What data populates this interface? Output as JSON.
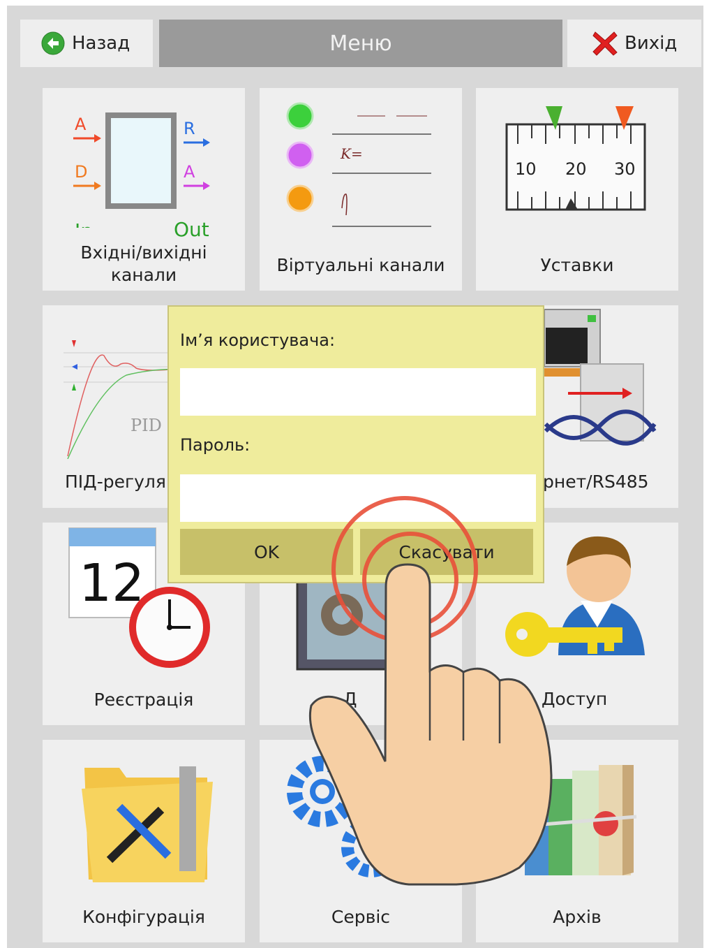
{
  "header": {
    "back_label": "Назад",
    "title": "Меню",
    "exit_label": "Вихід"
  },
  "tiles": [
    {
      "label_line1": "Вхідні/вихідні",
      "label_line2": "канали",
      "in": "In",
      "out": "Out",
      "a1": "A",
      "d": "D",
      "r": "R",
      "a2": "A"
    },
    {
      "label": "Віртуальні канали",
      "formula_k": "K="
    },
    {
      "label": "Уставки",
      "scale": [
        "10",
        "20",
        "30"
      ]
    },
    {
      "label": "ПІД-регуля",
      "pid_text": "PID"
    },
    {
      "label": "рнет/RS485"
    },
    {
      "label": "Реєстрація",
      "day": "12"
    },
    {
      "label": "Д"
    },
    {
      "label": "Доступ"
    },
    {
      "label": "Конфігурація"
    },
    {
      "label": "Сервіс"
    },
    {
      "label": "Архів"
    }
  ],
  "dialog": {
    "username_label": "Ім’я користувача:",
    "username_value": "",
    "password_label": "Пароль:",
    "password_value": "",
    "ok_label": "OK",
    "cancel_label": "Скасувати"
  },
  "colors": {
    "background": "#d8d8d8",
    "title_bar": "#9a9a9a",
    "tile": "#efefef",
    "dialog": "#efec9c",
    "dialog_button": "#c7c069",
    "exit_x": "#e02020",
    "back_icon": "#3aa83a"
  }
}
